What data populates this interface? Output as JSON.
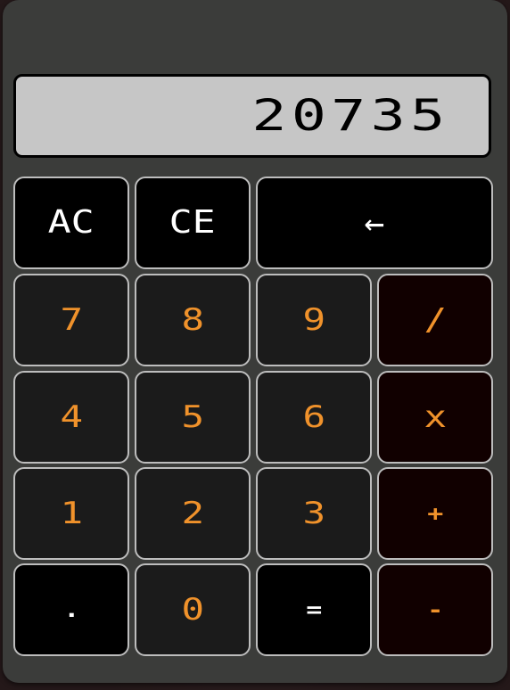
{
  "display": {
    "value": "20735"
  },
  "keys": {
    "ac": "AC",
    "ce": "CE",
    "backspace": "←",
    "seven": "7",
    "eight": "8",
    "nine": "9",
    "divide": "/",
    "four": "4",
    "five": "5",
    "six": "6",
    "multiply": "x",
    "one": "1",
    "two": "2",
    "three": "3",
    "plus": "+",
    "dot": ".",
    "zero": "0",
    "equals": "=",
    "minus": "-"
  },
  "colors": {
    "body": "#3b3c3a",
    "display": "#c6c6c6",
    "digit_text": "#f0922b",
    "function_key_bg": "#000000",
    "digit_key_bg": "#1b1b1b",
    "operator_key_bg": "#110000"
  }
}
